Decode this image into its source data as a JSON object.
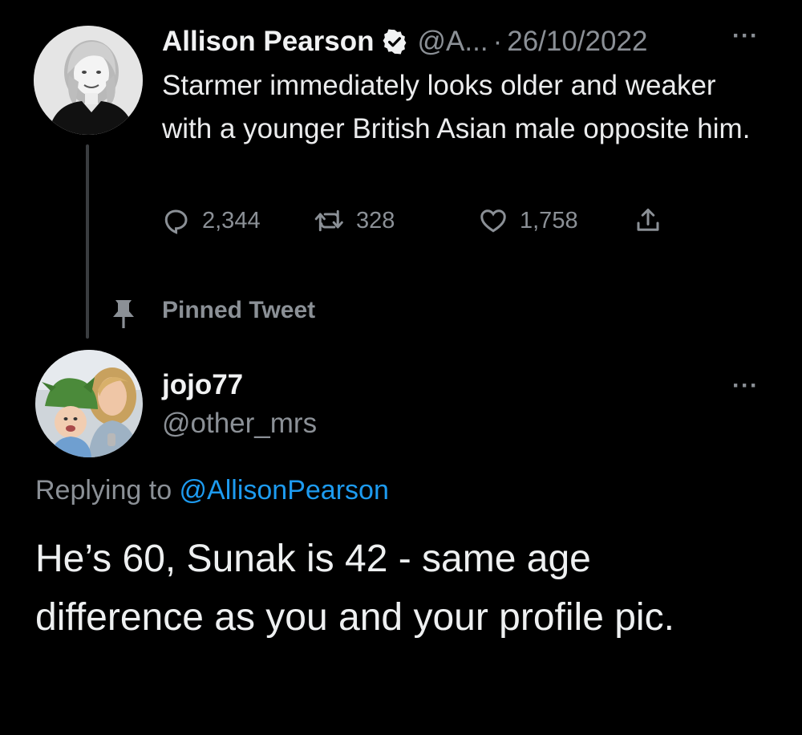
{
  "original_tweet": {
    "author_name": "Allison Pearson",
    "author_handle": "@A...",
    "separator": "·",
    "date": "26/10/2022",
    "text": "Starmer immediately looks older and weaker with a younger British Asian male opposite him.",
    "more_icon": "···",
    "verified_icon": "verified-badge-icon",
    "stats": {
      "replies": "2,344",
      "retweets": "328",
      "likes": "1,758"
    }
  },
  "pinned": {
    "label": "Pinned Tweet",
    "icon": "pin-icon"
  },
  "reply": {
    "author_name": "jojo77",
    "author_handle": "@other_mrs",
    "more_icon": "···",
    "replying_prefix": "Replying to ",
    "replying_mention": "@AllisonPearson",
    "text": "He’s 60, Sunak is 42 - same age difference as you and your profile pic."
  },
  "colors": {
    "background": "#000000",
    "text_primary": "#e7e9ea",
    "text_secondary": "#8b9096",
    "link": "#1d9bf0"
  }
}
